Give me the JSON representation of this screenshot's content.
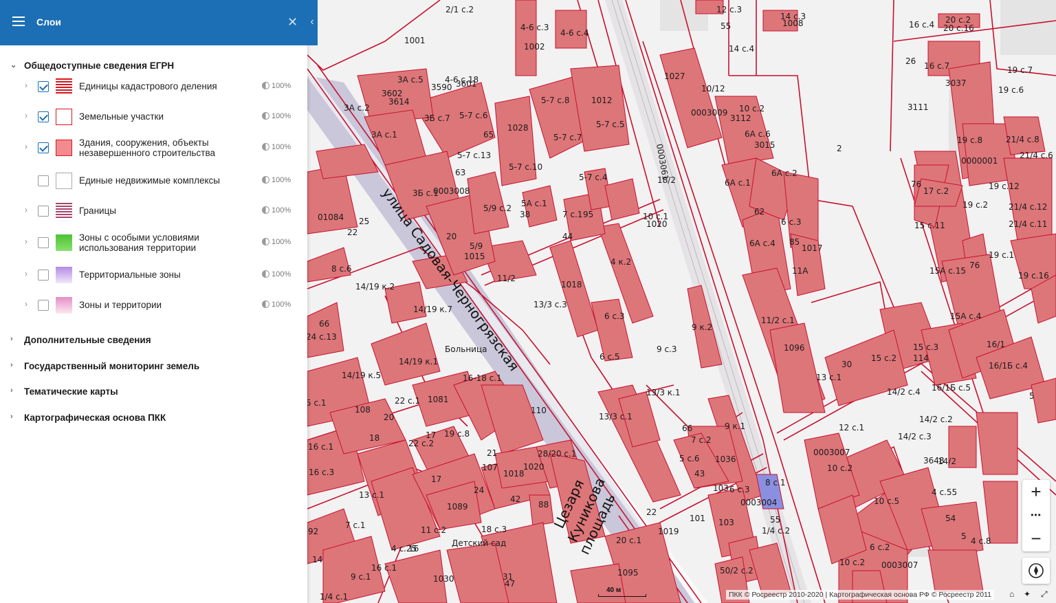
{
  "panel": {
    "title": "Слои",
    "sections": [
      {
        "title": "Общедоступные сведения ЕГРН",
        "expanded": true
      },
      {
        "title": "Дополнительные сведения",
        "expanded": false
      },
      {
        "title": "Государственный мониторинг земель",
        "expanded": false
      },
      {
        "title": "Тематические карты",
        "expanded": false
      },
      {
        "title": "Картографическая основа ПКК",
        "expanded": false
      }
    ],
    "layers": [
      {
        "name": "Единицы кадастрового деления",
        "checked": true,
        "opacity": "100%",
        "swatch": "stripes-red",
        "expandable": true
      },
      {
        "name": "Земельные участки",
        "checked": true,
        "opacity": "100%",
        "swatch": "outline-red",
        "expandable": true
      },
      {
        "name": "Здания, сооружения, объекты незавершенного строительства",
        "checked": true,
        "opacity": "100%",
        "swatch": "fill-red",
        "expandable": true
      },
      {
        "name": "Единые недвижимые комплексы",
        "checked": false,
        "opacity": "100%",
        "swatch": "outline-gray",
        "expandable": false
      },
      {
        "name": "Границы",
        "checked": false,
        "opacity": "100%",
        "swatch": "stripes-purple",
        "expandable": true
      },
      {
        "name": "Зоны с особыми условиями использования территории",
        "checked": false,
        "opacity": "100%",
        "swatch": "gradient-green",
        "expandable": true
      },
      {
        "name": "Территориальные зоны",
        "checked": false,
        "opacity": "100%",
        "swatch": "gradient-violet",
        "expandable": true
      },
      {
        "name": "Зоны и территории",
        "checked": false,
        "opacity": "100%",
        "swatch": "gradient-pink",
        "expandable": true
      }
    ]
  },
  "map": {
    "streets": [
      {
        "label": "улица Садовая-Черногрязская"
      },
      {
        "label": "Цезаря"
      },
      {
        "label": "Куникова"
      },
      {
        "label": "площадь"
      }
    ],
    "places": [
      "Больница",
      "Детский сад"
    ],
    "block_codes": [
      "0003009",
      "0003061",
      "0003008",
      "01084",
      "0003007",
      "0003004",
      "0003007",
      "0000001"
    ],
    "labels": [
      "2/1 с.2",
      "4-6 с.3",
      "4-6 с.4",
      "1002",
      "1001",
      "12 с.3",
      "14 с.3",
      "1008",
      "20 с.2",
      "20 с.16",
      "16 с.4",
      "55",
      "14 с.4",
      "3А с.5",
      "4-6 с.18",
      "3590",
      "3601",
      "3602",
      "3614",
      "3А с.2",
      "5-7 с.8",
      "5-7 с.5",
      "1027",
      "10/12",
      "26",
      "16 с.7",
      "19 с.7",
      "19 с.6",
      "3037",
      "3111",
      "3Б с.7",
      "5-7 с.6",
      "65",
      "1028",
      "1012",
      "3112",
      "10 с.2",
      "6А с.6",
      "3015",
      "3А с.1",
      "5-7 с.7",
      "19 с.8",
      "21/4 с.8",
      "21/4 с.6",
      "5-7 с.13",
      "5-7 с.10",
      "2",
      "63",
      "5-7 с.4",
      "18/2",
      "6А с.2",
      "6А с.1",
      "3Б с.1",
      "5/9 с.2",
      "5А с.1",
      "38",
      "7 с.1",
      "95",
      "10 с.1",
      "1020",
      "17 с.2",
      "19 с.12",
      "76",
      "21/4 с.12",
      "15 с.11",
      "19 с.2",
      "21/4 с.11",
      "25",
      "22",
      "20",
      "44",
      "6 с.3",
      "62",
      "6А с.4",
      "85",
      "1017",
      "4 к.2",
      "5/9",
      "1015",
      "8 с.6",
      "11/2",
      "1018",
      "11А",
      "19 с.1",
      "15А с.15",
      "76",
      "19 с.16",
      "14/19 к.2",
      "13/3 с.3",
      "6 с.3",
      "9 к.2",
      "14/19 к.7",
      "11/2 с.1",
      "1096",
      "15А с.4",
      "24 с.13",
      "66",
      "9 с.3",
      "14/19 к.1",
      "6 с.5",
      "16/1",
      "16/1Б с.4",
      "15 с.3",
      "15 с.2",
      "114",
      "14/19 к.5",
      "16-18 с.1",
      "13/3 к.1",
      "13 с.1",
      "30",
      "16/1Б с.5",
      "14/2 с.4",
      "5",
      "22 с.1",
      "1081",
      "108",
      "20",
      "110",
      "13/3 с.1",
      "12 с.1",
      "14/2 с.2",
      "14/2 с.3",
      "5 с.1",
      "18",
      "17",
      "22 с.2",
      "19 с.8",
      "66",
      "7 с.2",
      "9 к.1",
      "3648",
      "14/2",
      "16 с.1",
      "28/20 с.1",
      "5 с.6",
      "1036",
      "10 с.2",
      "21",
      "16 с.3",
      "107",
      "1018",
      "1020",
      "43",
      "103",
      "8 с.1",
      "10 с.5",
      "4 с.55",
      "17",
      "24",
      "88",
      "6 с.3",
      "54",
      "13 с.1",
      "1089",
      "22",
      "42",
      "1019",
      "101",
      "103",
      "1/4 с.2",
      "6 с.2",
      "7 с.1",
      "11 с.2",
      "18 с.3",
      "20 с.1",
      "92",
      "5",
      "4 с.8",
      "4 с.25",
      "16",
      "16 с.1",
      "14",
      "9 с.1",
      "1030",
      "31",
      "47",
      "1095",
      "50/2 с.2",
      "1/4 с.1",
      "10 с.2",
      "55"
    ],
    "scale": "40 м",
    "attribution": "ПКК © Росреестр 2010-2020 | Картографическая основа РФ © Росреестр 2011"
  },
  "controls": {
    "zoom_in": "+",
    "more": "•••",
    "zoom_out": "−"
  },
  "colors": {
    "header": "#1c6fb5",
    "building": "#dd7679",
    "parcel_line": "#c8102e",
    "street": "#c9c7d9"
  }
}
